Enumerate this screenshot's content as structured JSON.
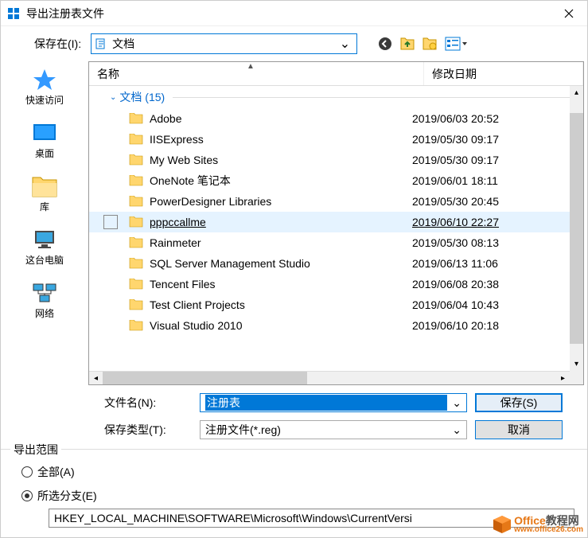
{
  "title": "导出注册表文件",
  "save_in_label": "保存在(I):",
  "save_in_value": "文档",
  "sidebar": [
    {
      "label": "快速访问",
      "key": "quickaccess"
    },
    {
      "label": "桌面",
      "key": "desktop"
    },
    {
      "label": "库",
      "key": "libraries"
    },
    {
      "label": "这台电脑",
      "key": "thispc"
    },
    {
      "label": "网络",
      "key": "network"
    }
  ],
  "columns": {
    "name": "名称",
    "date": "修改日期"
  },
  "group_header": "文档 (15)",
  "files": [
    {
      "name": "Adobe",
      "date": "2019/06/03 20:52"
    },
    {
      "name": "IISExpress",
      "date": "2019/05/30 09:17"
    },
    {
      "name": "My Web Sites",
      "date": "2019/05/30 09:17"
    },
    {
      "name": "OneNote 笔记本",
      "date": "2019/06/01 18:11"
    },
    {
      "name": "PowerDesigner Libraries",
      "date": "2019/05/30 20:45"
    },
    {
      "name": "pppccallme",
      "date": "2019/06/10 22:27"
    },
    {
      "name": "Rainmeter",
      "date": "2019/05/30 08:13"
    },
    {
      "name": "SQL Server Management Studio",
      "date": "2019/06/13 11:06"
    },
    {
      "name": "Tencent Files",
      "date": "2019/06/08 20:38"
    },
    {
      "name": "Test Client Projects",
      "date": "2019/06/04 10:43"
    },
    {
      "name": "Visual Studio 2010",
      "date": "2019/06/10 20:18"
    }
  ],
  "selected_index": 5,
  "filename_label": "文件名(N):",
  "filename_value": "注册表",
  "filetype_label": "保存类型(T):",
  "filetype_value": "注册文件(*.reg)",
  "save_btn": "保存(S)",
  "cancel_btn": "取消",
  "export_range_label": "导出范围",
  "radio_all": "全部(A)",
  "radio_selected": "所选分支(E)",
  "registry_path": "HKEY_LOCAL_MACHINE\\SOFTWARE\\Microsoft\\Windows\\CurrentVersi",
  "watermark": {
    "brand_a": "Office",
    "brand_b": "教程网",
    "url": "www.office26.com"
  }
}
